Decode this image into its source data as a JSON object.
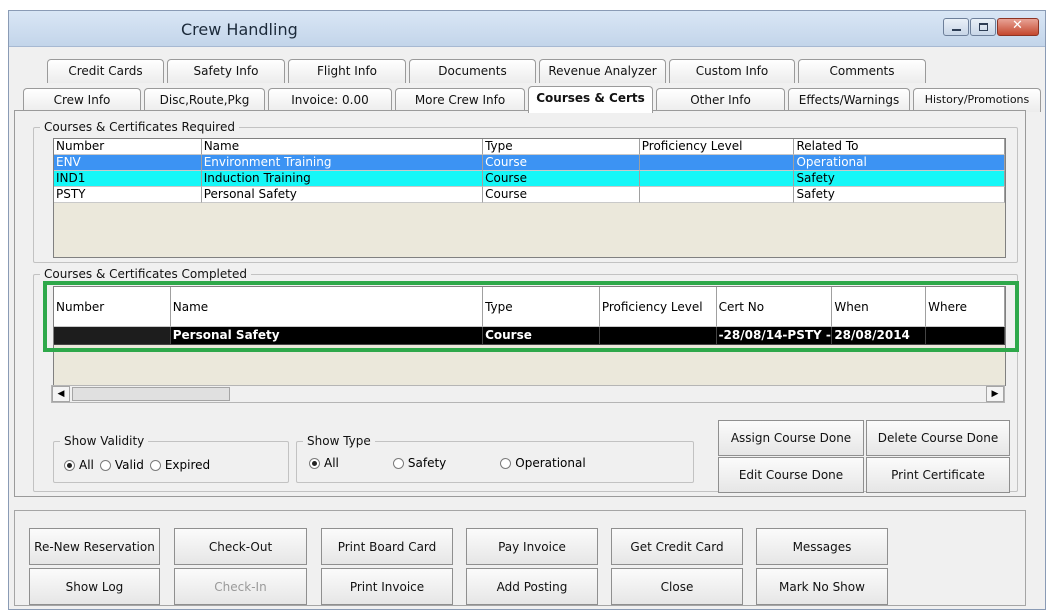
{
  "window": {
    "title": "Crew Handling"
  },
  "tabs_row1": [
    {
      "label": "Credit Cards"
    },
    {
      "label": "Safety Info"
    },
    {
      "label": "Flight Info"
    },
    {
      "label": "Documents"
    },
    {
      "label": "Revenue Analyzer"
    },
    {
      "label": "Custom Info"
    },
    {
      "label": "Comments"
    }
  ],
  "tabs_row2": [
    {
      "label": "Crew Info"
    },
    {
      "label": "Disc,Route,Pkg"
    },
    {
      "label": "Invoice: 0.00"
    },
    {
      "label": "More Crew Info"
    },
    {
      "label": "Courses & Certs"
    },
    {
      "label": "Other Info"
    },
    {
      "label": "Effects/Warnings"
    },
    {
      "label": "History/Promotions"
    }
  ],
  "required": {
    "legend": "Courses & Certificates Required",
    "columns": [
      "Number",
      "Name",
      "Type",
      "Proficiency Level",
      "Related To"
    ],
    "rows": [
      {
        "number": "ENV",
        "name": "Environment Training",
        "type": "Course",
        "proficiency": "",
        "related": "Operational"
      },
      {
        "number": "IND1",
        "name": "Induction Training",
        "type": "Course",
        "proficiency": "",
        "related": "Safety"
      },
      {
        "number": "PSTY",
        "name": "Personal Safety",
        "type": "Course",
        "proficiency": "",
        "related": "Safety"
      }
    ]
  },
  "completed": {
    "legend": "Courses & Certificates Completed",
    "columns": [
      "Number",
      "Name",
      "Type",
      "Proficiency Level",
      "Cert No",
      "When",
      "Where"
    ],
    "rows": [
      {
        "number": "",
        "name": "Personal Safety",
        "type": "Course",
        "proficiency": "",
        "cert_no": "-28/08/14-PSTY  -:",
        "when": "28/08/2014",
        "where": ""
      }
    ]
  },
  "show_validity": {
    "legend": "Show Validity",
    "options": [
      "All",
      "Valid",
      "Expired"
    ],
    "selected": "All"
  },
  "show_type": {
    "legend": "Show Type",
    "options": [
      "All",
      "Safety",
      "Operational"
    ],
    "selected": "All"
  },
  "course_buttons": {
    "assign": "Assign Course Done",
    "delete": "Delete Course Done",
    "edit": "Edit Course Done",
    "print": "Print Certificate"
  },
  "bottom_buttons": {
    "renew": "Re-New Reservation",
    "checkout": "Check-Out",
    "print_board": "Print Board Card",
    "pay_invoice": "Pay Invoice",
    "get_credit": "Get Credit Card",
    "messages": "Messages",
    "show_log": "Show Log",
    "checkin": "Check-In",
    "print_invoice": "Print Invoice",
    "add_posting": "Add Posting",
    "close": "Close",
    "mark_no_show": "Mark No Show"
  },
  "colors": {
    "selected_row": "#3c93f3",
    "cyan_row": "#16f7f7",
    "highlight_border": "#2ea84a"
  }
}
